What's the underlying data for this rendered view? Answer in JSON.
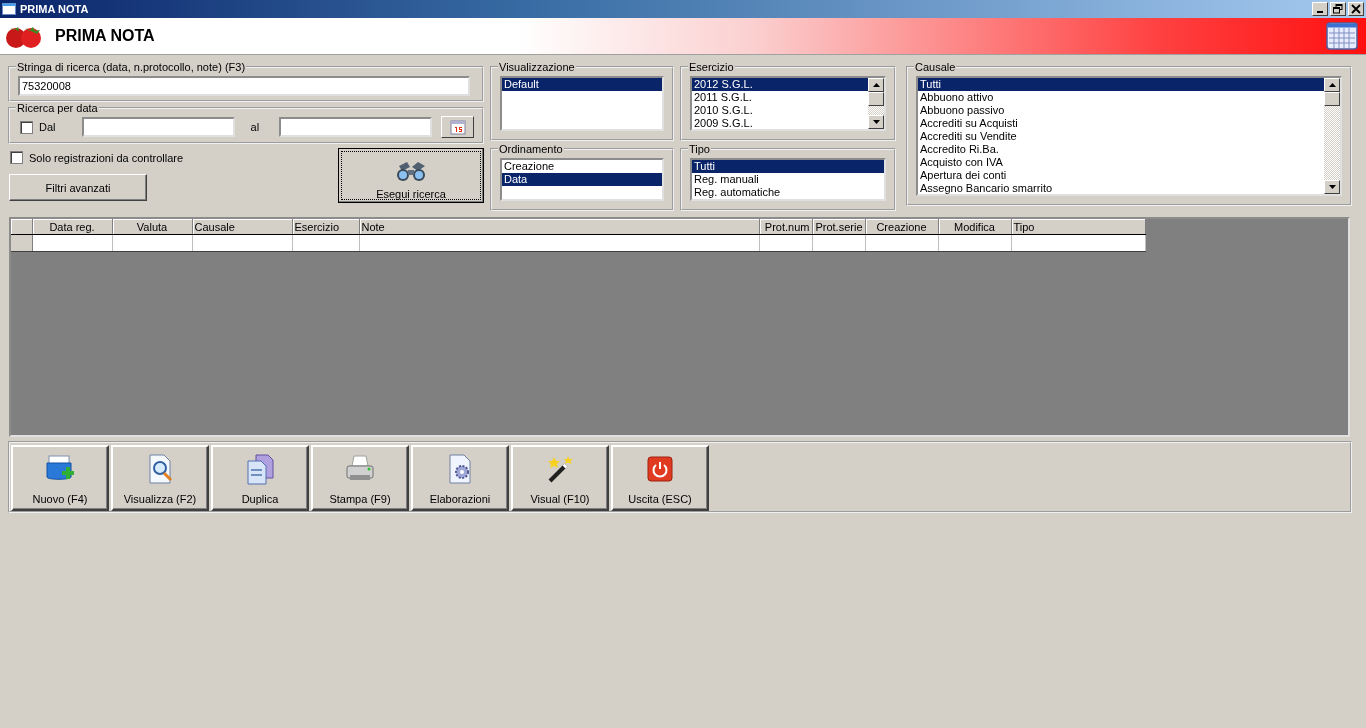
{
  "window": {
    "title": "PRIMA NOTA"
  },
  "header": {
    "title": "PRIMA NOTA"
  },
  "search": {
    "label": "Stringa di ricerca (data, n.protocollo, note) (F3)",
    "value": "75320008"
  },
  "date_search": {
    "label": "Ricerca per data",
    "from": {
      "label": "Dal",
      "checked": false
    },
    "to_label": "al"
  },
  "only_to_check": {
    "label": "Solo registrazioni da controllare",
    "checked": false
  },
  "advanced_filters_button": "Filtri avanzati",
  "search_button": "Esegui ricerca",
  "lists": [
    {
      "title": "Visualizzazione",
      "kind": "plain",
      "items": [
        {
          "label": "Default",
          "selected": true
        }
      ]
    },
    {
      "title": "Ordinamento",
      "kind": "plain",
      "items": [
        {
          "label": "Creazione",
          "selected": false
        },
        {
          "label": "Data",
          "selected": true
        }
      ]
    },
    {
      "title": "Esercizio",
      "kind": "scroll",
      "items": [
        {
          "label": "2012 S.G.L.",
          "selected": true
        },
        {
          "label": "2011 S.G.L.",
          "selected": false
        },
        {
          "label": "2010 S.G.L.",
          "selected": false
        },
        {
          "label": "2009 S.G.L.",
          "selected": false
        }
      ]
    },
    {
      "title": "Tipo",
      "kind": "plain",
      "items": [
        {
          "label": "Tutti",
          "selected": true
        },
        {
          "label": "Reg. manuali",
          "selected": false
        },
        {
          "label": "Reg. automatiche",
          "selected": false
        }
      ]
    },
    {
      "title": "Causale",
      "kind": "scroll",
      "items": [
        {
          "label": "Tutti",
          "selected": true
        },
        {
          "label": "Abbuono attivo",
          "selected": false
        },
        {
          "label": "Abbuono passivo",
          "selected": false
        },
        {
          "label": "Accrediti su Acquisti",
          "selected": false
        },
        {
          "label": "Accrediti su Vendite",
          "selected": false
        },
        {
          "label": "Accredito Ri.Ba.",
          "selected": false
        },
        {
          "label": "Acquisto con IVA",
          "selected": false
        },
        {
          "label": "Apertura dei conti",
          "selected": false
        },
        {
          "label": "Assegno Bancario smarrito",
          "selected": false
        }
      ]
    }
  ],
  "grid": {
    "columns": [
      {
        "label": "Data reg."
      },
      {
        "label": "Valuta"
      },
      {
        "label": "Causale"
      },
      {
        "label": "Esercizio"
      },
      {
        "label": "Note"
      },
      {
        "label": "Prot.num"
      },
      {
        "label": "Prot.serie"
      },
      {
        "label": "Creazione"
      },
      {
        "label": "Modifica"
      },
      {
        "label": "Tipo"
      }
    ]
  },
  "toolbar": [
    {
      "label": "Nuovo (F4)",
      "kind": "new"
    },
    {
      "label": "Visualizza (F2)",
      "kind": "view"
    },
    {
      "label": "Duplica",
      "kind": "duplicate"
    },
    {
      "label": "Stampa (F9)",
      "kind": "print"
    },
    {
      "label": "Elaborazioni",
      "kind": "process"
    },
    {
      "label": "Visual (F10)",
      "kind": "wand"
    },
    {
      "label": "Uscita (ESC)",
      "kind": "exit"
    }
  ]
}
